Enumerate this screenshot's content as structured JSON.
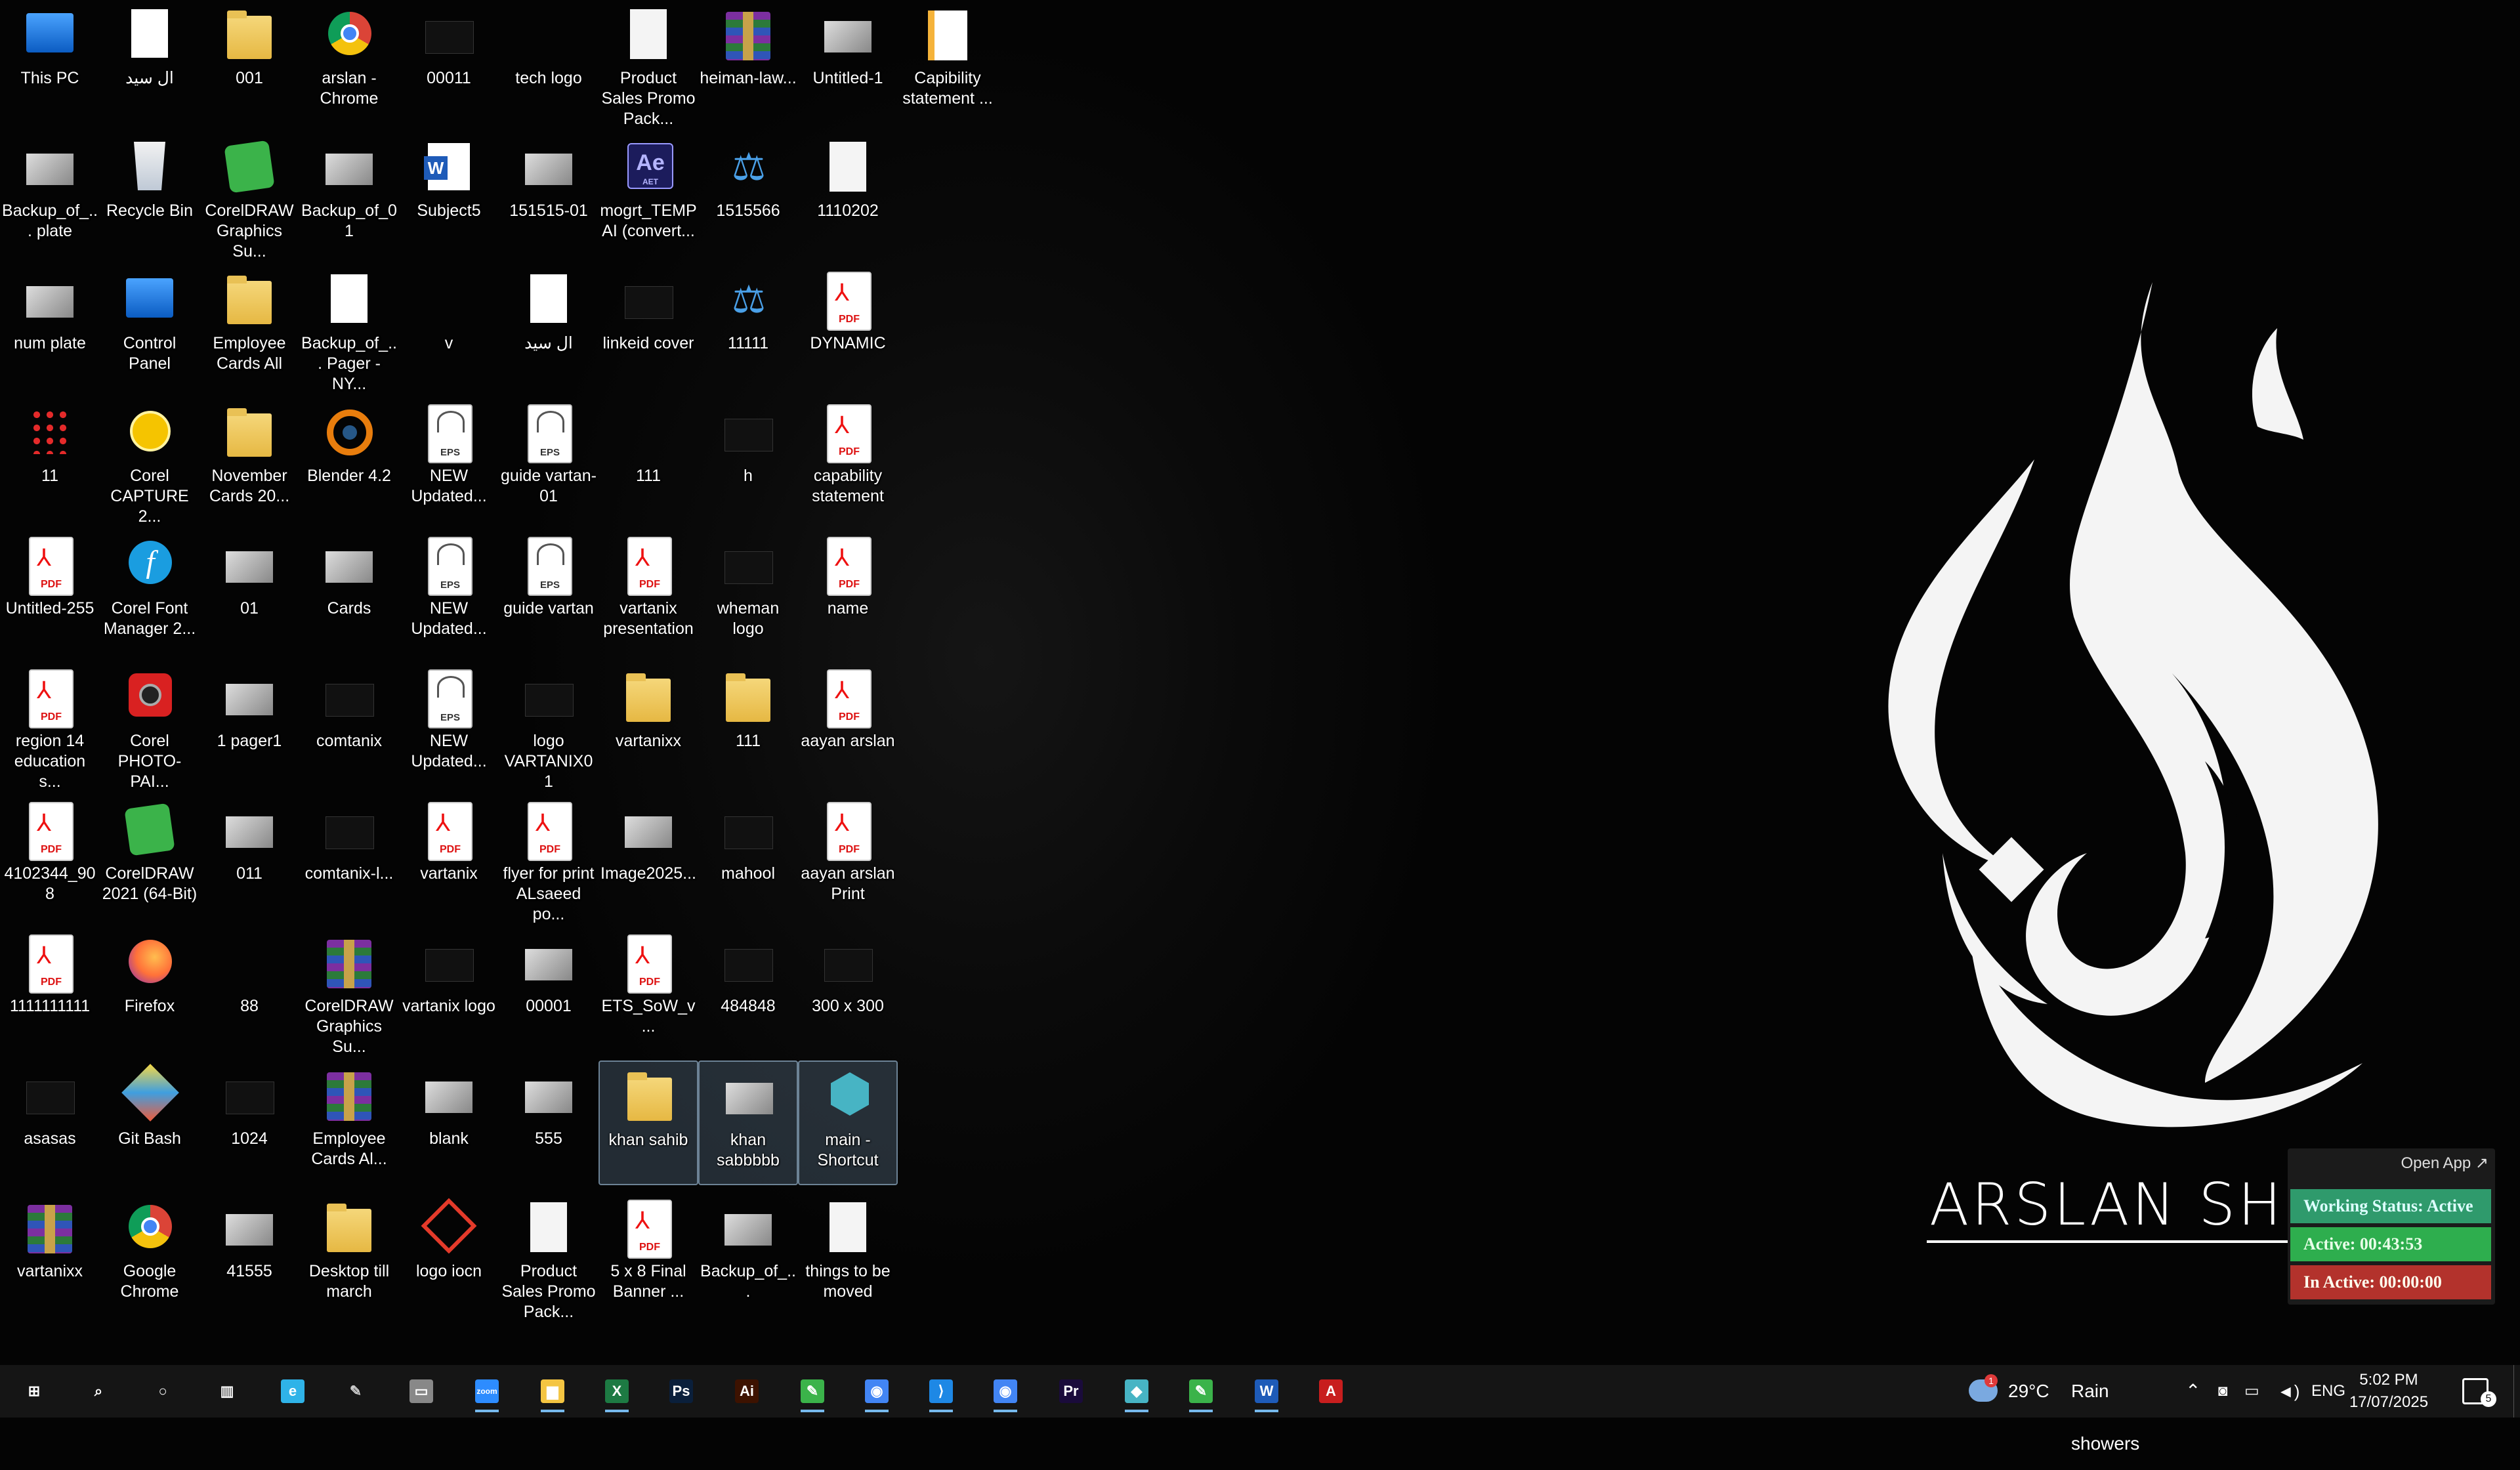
{
  "desktop": {
    "icons": [
      [
        "This PC",
        "Backup_of_... plate",
        "num plate",
        "11",
        "Untitled-255",
        "region 14 education s...",
        "4102344_908",
        "1111111111",
        "asasas",
        "vartanixx"
      ],
      [
        "ال سيد",
        "Recycle Bin",
        "Control Panel",
        "Corel CAPTURE 2...",
        "Corel Font Manager 2...",
        "Corel PHOTO-PAI...",
        "CorelDRAW 2021 (64-Bit)",
        "Firefox",
        "Git Bash",
        "Google Chrome"
      ],
      [
        "001",
        "CorelDRAW Graphics Su...",
        "Employee Cards All",
        "November Cards 20...",
        "01",
        "1 pager1",
        "011",
        "88",
        "1024",
        "41555"
      ],
      [
        "arslan - Chrome",
        "Backup_of_01",
        "Backup_of_... Pager - NY...",
        "Blender 4.2",
        "Cards",
        "comtanix",
        "comtanix-l...",
        "CorelDRAW Graphics Su...",
        "Employee Cards Al...",
        "Desktop till march"
      ],
      [
        "00011",
        "Subject5",
        "v",
        "NEW Updated...",
        "NEW Updated...",
        "NEW Updated...",
        "vartanix",
        "vartanix logo",
        "blank",
        "logo iocn"
      ],
      [
        "tech logo",
        "151515-01",
        "ال سيد",
        "guide vartan-01",
        "guide vartan",
        "logo VARTANIX01",
        "flyer for print ALsaeed po...",
        "00001",
        "555",
        "Product Sales Promo Pack..."
      ],
      [
        "Product Sales Promo Pack...",
        "mogrt_TEMP AI (convert...",
        "linkeid cover",
        "111",
        "vartanix presentation",
        "vartanixx",
        "Image2025...",
        "ETS_SoW_v...",
        "khan sahib",
        "5 x 8 Final Banner ..."
      ],
      [
        "heiman-law...",
        "1515566",
        "11111",
        "h",
        "wheman logo",
        "111",
        "mahool",
        "484848",
        "khan sabbbbb",
        "Backup_of_..."
      ],
      [
        "Untitled-1",
        "1110202",
        "DYNAMIC",
        "capability statement",
        "name",
        "aayan arslan",
        "aayan arslan Print",
        "300 x 300",
        "main - Shortcut",
        "things to be moved"
      ],
      [
        "Capibility statement ..."
      ]
    ],
    "icon_kinds": [
      [
        "sys",
        "img-thumb",
        "img-thumb",
        "red-dots",
        "pdf",
        "pdf",
        "pdf",
        "pdf",
        "dark-thumb",
        "rar"
      ],
      [
        "doc",
        "recycle",
        "sys",
        "cc",
        "font",
        "cam",
        "corel",
        "firefox",
        "git",
        "chrome"
      ],
      [
        "folder",
        "corel",
        "folder",
        "folder",
        "img-thumb",
        "img-thumb",
        "img-thumb",
        "txt-red",
        "dark-thumb",
        "img-thumb"
      ],
      [
        "chrome",
        "img-thumb",
        "doc",
        "blender",
        "img-thumb",
        "dark-thumb",
        "dark-thumb",
        "rar",
        "rar",
        "folder"
      ],
      [
        "dark-thumb",
        "word",
        "txt-red",
        "eps",
        "eps",
        "eps",
        "pdf",
        "dark-thumb",
        "img-thumb",
        "logo-red"
      ],
      [
        "txt-red",
        "img-thumb",
        "doc",
        "eps",
        "eps",
        "dark-thumb",
        "pdf",
        "img-thumb",
        "img-thumb",
        "white-page"
      ],
      [
        "white-page",
        "ae",
        "dark-thumb",
        "txt-red",
        "pdf",
        "folder",
        "img-thumb",
        "pdf",
        "folder",
        "pdf"
      ],
      [
        "rar",
        "scale",
        "scale",
        "dark-thumb",
        "dark-thumb",
        "folder",
        "dark-thumb",
        "dark-thumb",
        "img-thumb",
        "img-thumb"
      ],
      [
        "img-thumb",
        "white-page",
        "pdf",
        "pdf",
        "pdf",
        "pdf",
        "pdf",
        "dark-thumb",
        "cube",
        "white-page"
      ],
      [
        "zip-doc"
      ]
    ],
    "selected_icons": [
      "khan sahib",
      "khan sabbbbb",
      "main - Shortcut"
    ]
  },
  "wallpaper": {
    "brand_text": "ARSLAN SHEIKH"
  },
  "tracker_widget": {
    "open_app": "Open App ↗",
    "working_status": "Working Status: Active",
    "active": "Active: 00:43:53",
    "inactive": "In Active: 00:00:00",
    "colors": {
      "status": "#2f9a6c",
      "active": "#2eae4e",
      "inactive": "#b3322c"
    }
  },
  "taskbar": {
    "apps": [
      {
        "name": "start",
        "glyph": "⊞",
        "color": "#ffffff"
      },
      {
        "name": "search",
        "glyph": "⌕",
        "color": "#ffffff"
      },
      {
        "name": "cortana",
        "glyph": "○",
        "color": "#ffffff"
      },
      {
        "name": "task-view",
        "glyph": "▥",
        "color": "#ffffff"
      },
      {
        "name": "edge",
        "glyph": "e",
        "color": "#2fb3e8"
      },
      {
        "name": "pen",
        "glyph": "✎",
        "color": "#cccccc"
      },
      {
        "name": "terminal",
        "glyph": "▭",
        "color": "#888888"
      },
      {
        "name": "zoom",
        "glyph": "zoom",
        "color": "#2d8cff"
      },
      {
        "name": "file-explorer",
        "glyph": "▆",
        "color": "#f4c542"
      },
      {
        "name": "excel",
        "glyph": "X",
        "color": "#1d7a43"
      },
      {
        "name": "photoshop",
        "glyph": "Ps",
        "color": "#0a1f3b"
      },
      {
        "name": "illustrator",
        "glyph": "Ai",
        "color": "#3d1200"
      },
      {
        "name": "coreldraw",
        "glyph": "✎",
        "color": "#3bb34a"
      },
      {
        "name": "chrome",
        "glyph": "◉",
        "color": "#4285f4"
      },
      {
        "name": "vscode",
        "glyph": "⟩",
        "color": "#1e88e5"
      },
      {
        "name": "chrome-profile",
        "glyph": "◉",
        "color": "#4285f4"
      },
      {
        "name": "premiere",
        "glyph": "Pr",
        "color": "#1a0b3b"
      },
      {
        "name": "app-cube",
        "glyph": "◆",
        "color": "#47b4c4"
      },
      {
        "name": "coreldraw-2",
        "glyph": "✎",
        "color": "#3bb34a"
      },
      {
        "name": "word",
        "glyph": "W",
        "color": "#1e5bb8"
      },
      {
        "name": "acrobat",
        "glyph": "A",
        "color": "#c81e1e"
      }
    ],
    "weather": {
      "temp": "29°C",
      "condition": "Rain showers",
      "badge": "1"
    },
    "language": "ENG",
    "time": "5:02 PM",
    "date": "17/07/2025",
    "notifications": "5"
  }
}
